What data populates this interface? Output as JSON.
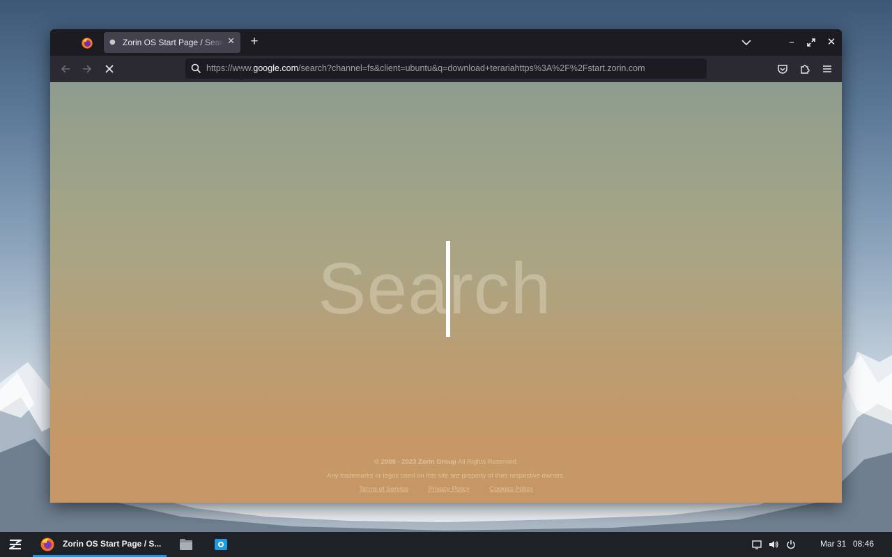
{
  "browser": {
    "tab_title": "Zorin OS Start Page / Search",
    "url_prefix": "https://www.",
    "url_domain": "google.com",
    "url_rest": "/search?channel=fs&client=ubuntu&q=download+terariahttps%3A%2F%2Fstart.zorin.com",
    "loading": true,
    "icons": {
      "tab": "firefox-icon",
      "new_tab": "plus-icon",
      "tab_list": "chevron-down-icon",
      "back": "back-arrow-icon",
      "forward": "forward-arrow-icon",
      "stop": "stop-icon",
      "pocket": "pocket-icon",
      "extensions": "puzzle-piece-icon",
      "menu": "hamburger-menu-icon"
    }
  },
  "page": {
    "search_placeholder": "Search",
    "footer_copyright_bold": "© 2008 - 2023 Zorin Group",
    "footer_copyright_rest": " All Rights Reserved.",
    "footer_trademark": "Any trademarks or logos used on this site are property of their respective owners.",
    "links": [
      "Terms of Service",
      "Privacy Policy",
      "Cookies Policy"
    ]
  },
  "taskbar": {
    "task_title": "Zorin OS Start Page / S...",
    "date": "Mar 31",
    "time": "08:46",
    "accent_color": "#2d8fdc"
  }
}
